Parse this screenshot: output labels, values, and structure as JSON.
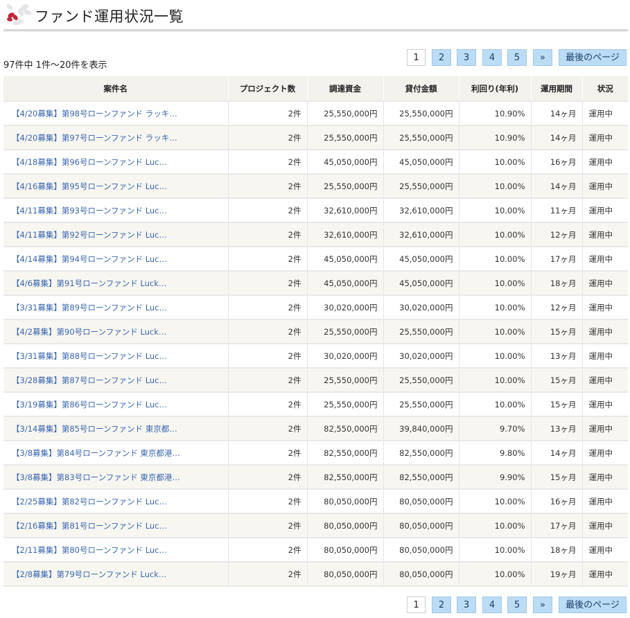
{
  "header": {
    "title": "ファンド運用状況一覧",
    "accent": "#c0283a"
  },
  "summary": {
    "count_text": "97件中 1件～20件を表示"
  },
  "pagination": {
    "pages": [
      "1",
      "2",
      "3",
      "4",
      "5"
    ],
    "current": "1",
    "next_label": "»",
    "last_label": "最後のページ"
  },
  "table": {
    "headers": [
      "案件名",
      "プロジェクト数",
      "調達資金",
      "貸付金額",
      "利回り(年利)",
      "運用期間",
      "状況"
    ],
    "rows": [
      {
        "name": "【4/20募集】第98号ローンファンド ラッキ…",
        "projects": "2件",
        "raised": "25,550,000円",
        "loan": "25,550,000円",
        "yield": "10.90%",
        "term": "14ヶ月",
        "status": "運用中"
      },
      {
        "name": "【4/20募集】第97号ローンファンド ラッキ…",
        "projects": "2件",
        "raised": "25,550,000円",
        "loan": "25,550,000円",
        "yield": "10.90%",
        "term": "14ヶ月",
        "status": "運用中"
      },
      {
        "name": "【4/18募集】第96号ローンファンド Luc…",
        "projects": "2件",
        "raised": "45,050,000円",
        "loan": "45,050,000円",
        "yield": "10.00%",
        "term": "16ヶ月",
        "status": "運用中"
      },
      {
        "name": "【4/16募集】第95号ローンファンド Luc…",
        "projects": "2件",
        "raised": "25,550,000円",
        "loan": "25,550,000円",
        "yield": "10.00%",
        "term": "14ヶ月",
        "status": "運用中"
      },
      {
        "name": "【4/11募集】第93号ローンファンド Luc…",
        "projects": "2件",
        "raised": "32,610,000円",
        "loan": "32,610,000円",
        "yield": "10.00%",
        "term": "11ヶ月",
        "status": "運用中"
      },
      {
        "name": "【4/11募集】第92号ローンファンド Luc…",
        "projects": "2件",
        "raised": "32,610,000円",
        "loan": "32,610,000円",
        "yield": "10.00%",
        "term": "12ヶ月",
        "status": "運用中"
      },
      {
        "name": "【4/14募集】第94号ローンファンド Luc…",
        "projects": "2件",
        "raised": "45,050,000円",
        "loan": "45,050,000円",
        "yield": "10.00%",
        "term": "17ヶ月",
        "status": "運用中"
      },
      {
        "name": "【4/6募集】第91号ローンファンド Luck…",
        "projects": "2件",
        "raised": "45,050,000円",
        "loan": "45,050,000円",
        "yield": "10.00%",
        "term": "18ヶ月",
        "status": "運用中"
      },
      {
        "name": "【3/31募集】第89号ローンファンド Luc…",
        "projects": "2件",
        "raised": "30,020,000円",
        "loan": "30,020,000円",
        "yield": "10.00%",
        "term": "12ヶ月",
        "status": "運用中"
      },
      {
        "name": "【4/2募集】第90号ローンファンド Luck…",
        "projects": "2件",
        "raised": "25,550,000円",
        "loan": "25,550,000円",
        "yield": "10.00%",
        "term": "15ヶ月",
        "status": "運用中"
      },
      {
        "name": "【3/31募集】第88号ローンファンド Luc…",
        "projects": "2件",
        "raised": "30,020,000円",
        "loan": "30,020,000円",
        "yield": "10.00%",
        "term": "13ヶ月",
        "status": "運用中"
      },
      {
        "name": "【3/28募集】第87号ローンファンド Luc…",
        "projects": "2件",
        "raised": "25,550,000円",
        "loan": "25,550,000円",
        "yield": "10.00%",
        "term": "15ヶ月",
        "status": "運用中"
      },
      {
        "name": "【3/19募集】第86号ローンファンド Luc…",
        "projects": "2件",
        "raised": "25,550,000円",
        "loan": "25,550,000円",
        "yield": "10.00%",
        "term": "15ヶ月",
        "status": "運用中"
      },
      {
        "name": "【3/14募集】第85号ローンファンド 東京都…",
        "projects": "2件",
        "raised": "82,550,000円",
        "loan": "39,840,000円",
        "yield": "9.70%",
        "term": "13ヶ月",
        "status": "運用中"
      },
      {
        "name": "【3/8募集】第84号ローンファンド 東京都港…",
        "projects": "2件",
        "raised": "82,550,000円",
        "loan": "82,550,000円",
        "yield": "9.80%",
        "term": "14ヶ月",
        "status": "運用中"
      },
      {
        "name": "【3/8募集】第83号ローンファンド 東京都港…",
        "projects": "2件",
        "raised": "82,550,000円",
        "loan": "82,550,000円",
        "yield": "9.90%",
        "term": "15ヶ月",
        "status": "運用中"
      },
      {
        "name": "【2/25募集】第82号ローンファンド Luc…",
        "projects": "2件",
        "raised": "80,050,000円",
        "loan": "80,050,000円",
        "yield": "10.00%",
        "term": "16ヶ月",
        "status": "運用中"
      },
      {
        "name": "【2/16募集】第81号ローンファンド Luc…",
        "projects": "2件",
        "raised": "80,050,000円",
        "loan": "80,050,000円",
        "yield": "10.00%",
        "term": "17ヶ月",
        "status": "運用中"
      },
      {
        "name": "【2/11募集】第80号ローンファンド Luc…",
        "projects": "2件",
        "raised": "80,050,000円",
        "loan": "80,050,000円",
        "yield": "10.00%",
        "term": "18ヶ月",
        "status": "運用中"
      },
      {
        "name": "【2/8募集】第79号ローンファンド Luck…",
        "projects": "2件",
        "raised": "80,050,000円",
        "loan": "80,050,000円",
        "yield": "10.00%",
        "term": "19ヶ月",
        "status": "運用中"
      }
    ]
  }
}
